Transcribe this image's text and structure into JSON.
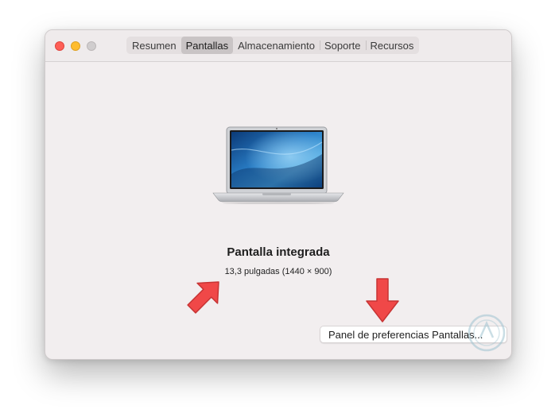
{
  "window": {
    "tabs": [
      {
        "label": "Resumen",
        "active": false
      },
      {
        "label": "Pantallas",
        "active": true
      },
      {
        "label": "Almacenamiento",
        "active": false
      },
      {
        "label": "Soporte",
        "active": false
      },
      {
        "label": "Recursos",
        "active": false
      }
    ]
  },
  "display": {
    "name": "Pantalla integrada",
    "size": "13,3 pulgadas (1440 × 900)",
    "image_icon": "macbook-air-icon"
  },
  "prefs_button_label": "Panel de preferencias Pantallas...",
  "colors": {
    "window_bg": "#f2eeef",
    "close": "#fe5f57",
    "minimize": "#febc2e",
    "arrow": "#f04848"
  }
}
